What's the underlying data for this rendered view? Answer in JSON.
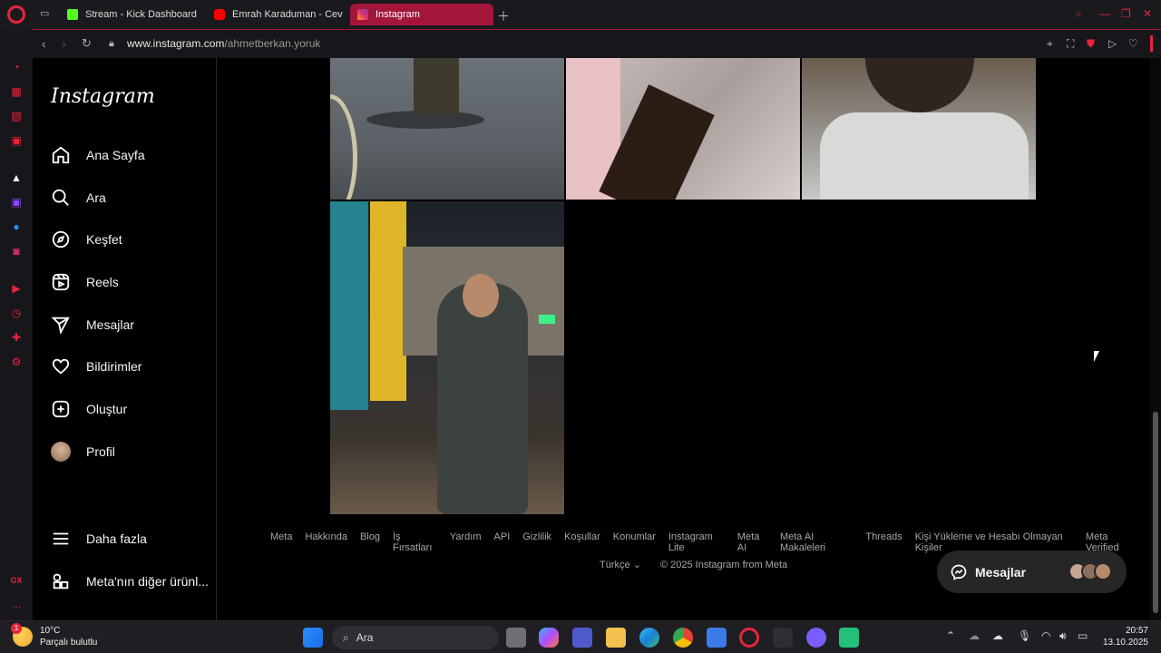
{
  "browser": {
    "tabs": [
      {
        "label": "Stream - Kick Dashboard",
        "favicon_color": "#53fc18"
      },
      {
        "label": "Emrah Karaduman - Cevap",
        "favicon_color": "#ff0000"
      },
      {
        "label": "Instagram",
        "favicon_color": "#e1306c",
        "active": true
      }
    ],
    "url_host": "www.instagram.com",
    "url_path": "/ahmetberkan.yoruk",
    "accent": "#e8243d"
  },
  "instagram": {
    "logo": "Instagram",
    "nav": [
      {
        "label": "Ana Sayfa",
        "icon": "home-icon"
      },
      {
        "label": "Ara",
        "icon": "search-icon"
      },
      {
        "label": "Keşfet",
        "icon": "compass-icon"
      },
      {
        "label": "Reels",
        "icon": "reels-icon"
      },
      {
        "label": "Mesajlar",
        "icon": "paper-plane-icon"
      },
      {
        "label": "Bildirimler",
        "icon": "heart-icon"
      },
      {
        "label": "Oluştur",
        "icon": "plus-square-icon"
      },
      {
        "label": "Profil",
        "icon": "avatar"
      }
    ],
    "more": "Daha fazla",
    "meta_apps": "Meta'nın diğer ürünl...",
    "footer_links": [
      "Meta",
      "Hakkında",
      "Blog",
      "İş Fırsatları",
      "Yardım",
      "API",
      "Gizlilik",
      "Koşullar",
      "Konumlar",
      "Instagram Lite",
      "Meta AI",
      "Meta AI Makaleleri",
      "Threads",
      "Kişi Yükleme ve Hesabı Olmayan Kişiler",
      "Meta Verified"
    ],
    "language": "Türkçe",
    "copyright": "© 2025 Instagram from Meta",
    "messages_pill": "Mesajlar"
  },
  "taskbar": {
    "temperature": "10°C",
    "weather": "Parçalı bulutlu",
    "weather_badge": "1",
    "search": "Ara",
    "time": "20:57",
    "date": "13.10.2025"
  }
}
